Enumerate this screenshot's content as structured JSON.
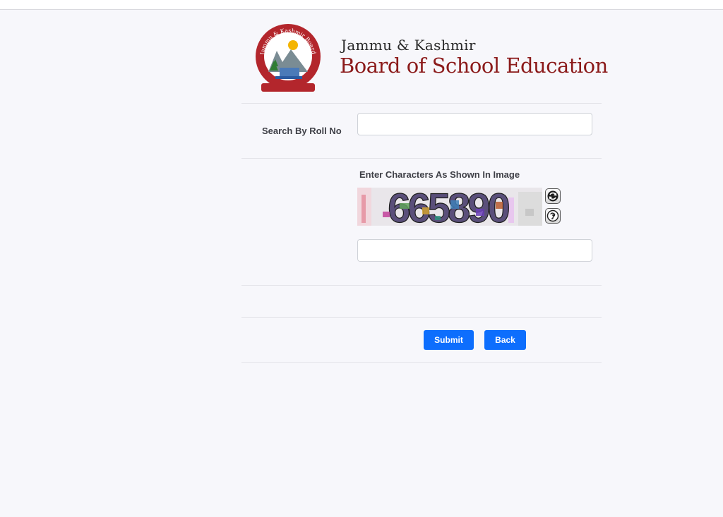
{
  "header": {
    "org_line1": "Jammu & Kashmir",
    "org_line2": "Board of School Education",
    "logo_ring_text": "Jammu & Kashmir Board Of School Education"
  },
  "form": {
    "roll_label": "Search By Roll No",
    "roll_value": "",
    "captcha_label": "Enter Characters As Shown In Image",
    "captcha_text": "665890",
    "captcha_value": "",
    "refresh_icon": "refresh-icon",
    "audio_icon": "audio-icon"
  },
  "buttons": {
    "submit": "Submit",
    "back": "Back"
  },
  "colors": {
    "accent": "#0d6efd",
    "brand": "#8b1a1a",
    "background": "#f7f7fb"
  }
}
